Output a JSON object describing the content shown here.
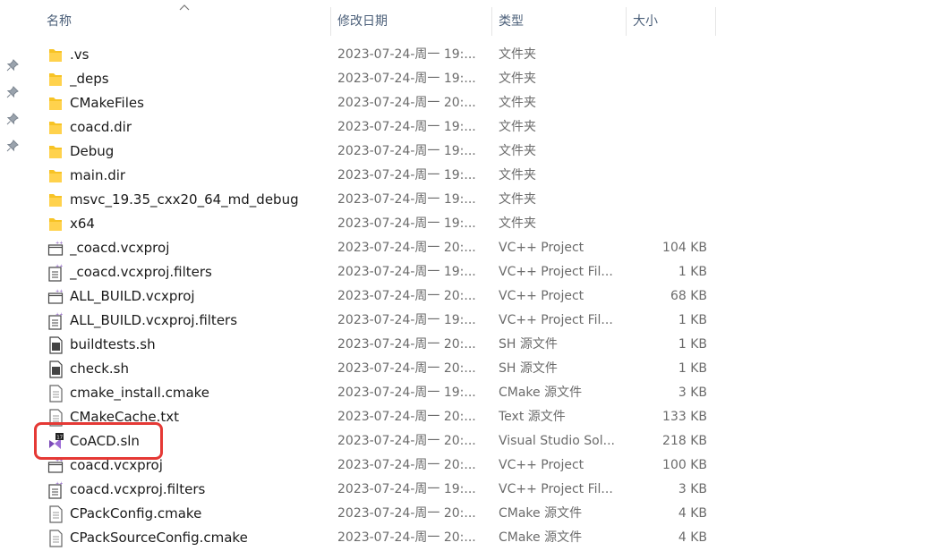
{
  "columns": {
    "name": "名称",
    "date": "修改日期",
    "type": "类型",
    "size": "大小"
  },
  "colors": {
    "folder": "#f7c325",
    "highlight": "#e53935",
    "vs_purple": "#7b4ab8"
  },
  "files": [
    {
      "name": ".vs",
      "date": "2023-07-24-周一 19:...",
      "type": "文件夹",
      "size": "",
      "icon": "folder-icon"
    },
    {
      "name": "_deps",
      "date": "2023-07-24-周一 19:...",
      "type": "文件夹",
      "size": "",
      "icon": "folder-icon"
    },
    {
      "name": "CMakeFiles",
      "date": "2023-07-24-周一 20:...",
      "type": "文件夹",
      "size": "",
      "icon": "folder-icon"
    },
    {
      "name": "coacd.dir",
      "date": "2023-07-24-周一 19:...",
      "type": "文件夹",
      "size": "",
      "icon": "folder-icon"
    },
    {
      "name": "Debug",
      "date": "2023-07-24-周一 19:...",
      "type": "文件夹",
      "size": "",
      "icon": "folder-icon"
    },
    {
      "name": "main.dir",
      "date": "2023-07-24-周一 19:...",
      "type": "文件夹",
      "size": "",
      "icon": "folder-icon"
    },
    {
      "name": "msvc_19.35_cxx20_64_md_debug",
      "date": "2023-07-24-周一 19:...",
      "type": "文件夹",
      "size": "",
      "icon": "folder-icon"
    },
    {
      "name": "x64",
      "date": "2023-07-24-周一 19:...",
      "type": "文件夹",
      "size": "",
      "icon": "folder-icon"
    },
    {
      "name": "_coacd.vcxproj",
      "date": "2023-07-24-周一 20:...",
      "type": "VC++ Project",
      "size": "104 KB",
      "icon": "vcxproj-icon"
    },
    {
      "name": "_coacd.vcxproj.filters",
      "date": "2023-07-24-周一 19:...",
      "type": "VC++ Project Fil...",
      "size": "1 KB",
      "icon": "filters-icon"
    },
    {
      "name": "ALL_BUILD.vcxproj",
      "date": "2023-07-24-周一 20:...",
      "type": "VC++ Project",
      "size": "68 KB",
      "icon": "vcxproj-icon"
    },
    {
      "name": "ALL_BUILD.vcxproj.filters",
      "date": "2023-07-24-周一 19:...",
      "type": "VC++ Project Fil...",
      "size": "1 KB",
      "icon": "filters-icon"
    },
    {
      "name": "buildtests.sh",
      "date": "2023-07-24-周一 20:...",
      "type": "SH 源文件",
      "size": "1 KB",
      "icon": "sh-file-icon"
    },
    {
      "name": "check.sh",
      "date": "2023-07-24-周一 20:...",
      "type": "SH 源文件",
      "size": "1 KB",
      "icon": "sh-file-icon"
    },
    {
      "name": "cmake_install.cmake",
      "date": "2023-07-24-周一 19:...",
      "type": "CMake 源文件",
      "size": "3 KB",
      "icon": "text-file-icon"
    },
    {
      "name": "CMakeCache.txt",
      "date": "2023-07-24-周一 20:...",
      "type": "Text 源文件",
      "size": "133 KB",
      "icon": "text-file-icon"
    },
    {
      "name": "CoACD.sln",
      "date": "2023-07-24-周一 20:...",
      "type": "Visual Studio Sol...",
      "size": "218 KB",
      "icon": "vs-solution-icon"
    },
    {
      "name": "coacd.vcxproj",
      "date": "2023-07-24-周一 20:...",
      "type": "VC++ Project",
      "size": "100 KB",
      "icon": "vcxproj-icon"
    },
    {
      "name": "coacd.vcxproj.filters",
      "date": "2023-07-24-周一 19:...",
      "type": "VC++ Project Fil...",
      "size": "3 KB",
      "icon": "filters-icon"
    },
    {
      "name": "CPackConfig.cmake",
      "date": "2023-07-24-周一 20:...",
      "type": "CMake 源文件",
      "size": "4 KB",
      "icon": "text-file-icon"
    },
    {
      "name": "CPackSourceConfig.cmake",
      "date": "2023-07-24-周一 20:...",
      "type": "CMake 源文件",
      "size": "4 KB",
      "icon": "text-file-icon"
    }
  ]
}
